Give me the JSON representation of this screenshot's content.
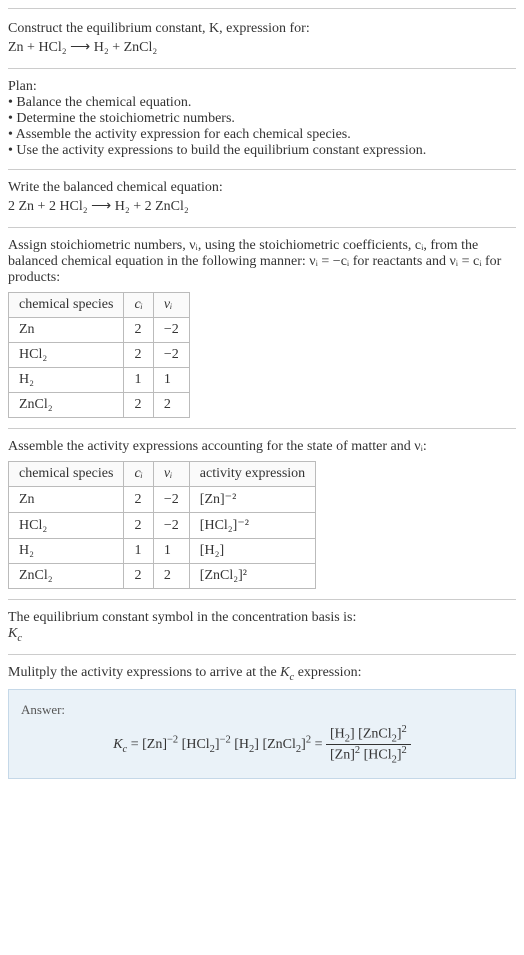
{
  "intro": {
    "line1": "Construct the equilibrium constant, K, expression for:",
    "equation": "Zn + HCl₂ ⟶ H₂ + ZnCl₂"
  },
  "plan": {
    "heading": "Plan:",
    "items": [
      "• Balance the chemical equation.",
      "• Determine the stoichiometric numbers.",
      "• Assemble the activity expression for each chemical species.",
      "• Use the activity expressions to build the equilibrium constant expression."
    ]
  },
  "balanced": {
    "heading": "Write the balanced chemical equation:",
    "equation": "2 Zn + 2 HCl₂ ⟶ H₂ + 2 ZnCl₂"
  },
  "assign": {
    "text": "Assign stoichiometric numbers, νᵢ, using the stoichiometric coefficients, cᵢ, from the balanced chemical equation in the following manner: νᵢ = −cᵢ for reactants and νᵢ = cᵢ for products:",
    "table": {
      "headers": [
        "chemical species",
        "cᵢ",
        "νᵢ"
      ],
      "rows": [
        [
          "Zn",
          "2",
          "−2"
        ],
        [
          "HCl₂",
          "2",
          "−2"
        ],
        [
          "H₂",
          "1",
          "1"
        ],
        [
          "ZnCl₂",
          "2",
          "2"
        ]
      ]
    }
  },
  "activity": {
    "text": "Assemble the activity expressions accounting for the state of matter and νᵢ:",
    "table": {
      "headers": [
        "chemical species",
        "cᵢ",
        "νᵢ",
        "activity expression"
      ],
      "rows": [
        [
          "Zn",
          "2",
          "−2",
          "[Zn]⁻²"
        ],
        [
          "HCl₂",
          "2",
          "−2",
          "[HCl₂]⁻²"
        ],
        [
          "H₂",
          "1",
          "1",
          "[H₂]"
        ],
        [
          "ZnCl₂",
          "2",
          "2",
          "[ZnCl₂]²"
        ]
      ]
    }
  },
  "symbol": {
    "text": "The equilibrium constant symbol in the concentration basis is:",
    "value": "K_c"
  },
  "multiply": {
    "text": "Mulitply the activity expressions to arrive at the K_c expression:"
  },
  "answer": {
    "label": "Answer:",
    "lhs": "K_c = [Zn]⁻² [HCl₂]⁻² [H₂] [ZnCl₂]² = ",
    "frac_num": "[H₂] [ZnCl₂]²",
    "frac_den": "[Zn]² [HCl₂]²"
  },
  "chart_data": {
    "type": "table",
    "tables": [
      {
        "title": "Stoichiometric numbers",
        "columns": [
          "chemical species",
          "c_i",
          "nu_i"
        ],
        "rows": [
          {
            "chemical species": "Zn",
            "c_i": 2,
            "nu_i": -2
          },
          {
            "chemical species": "HCl2",
            "c_i": 2,
            "nu_i": -2
          },
          {
            "chemical species": "H2",
            "c_i": 1,
            "nu_i": 1
          },
          {
            "chemical species": "ZnCl2",
            "c_i": 2,
            "nu_i": 2
          }
        ]
      },
      {
        "title": "Activity expressions",
        "columns": [
          "chemical species",
          "c_i",
          "nu_i",
          "activity expression"
        ],
        "rows": [
          {
            "chemical species": "Zn",
            "c_i": 2,
            "nu_i": -2,
            "activity expression": "[Zn]^-2"
          },
          {
            "chemical species": "HCl2",
            "c_i": 2,
            "nu_i": -2,
            "activity expression": "[HCl2]^-2"
          },
          {
            "chemical species": "H2",
            "c_i": 1,
            "nu_i": 1,
            "activity expression": "[H2]"
          },
          {
            "chemical species": "ZnCl2",
            "c_i": 2,
            "nu_i": 2,
            "activity expression": "[ZnCl2]^2"
          }
        ]
      }
    ]
  }
}
